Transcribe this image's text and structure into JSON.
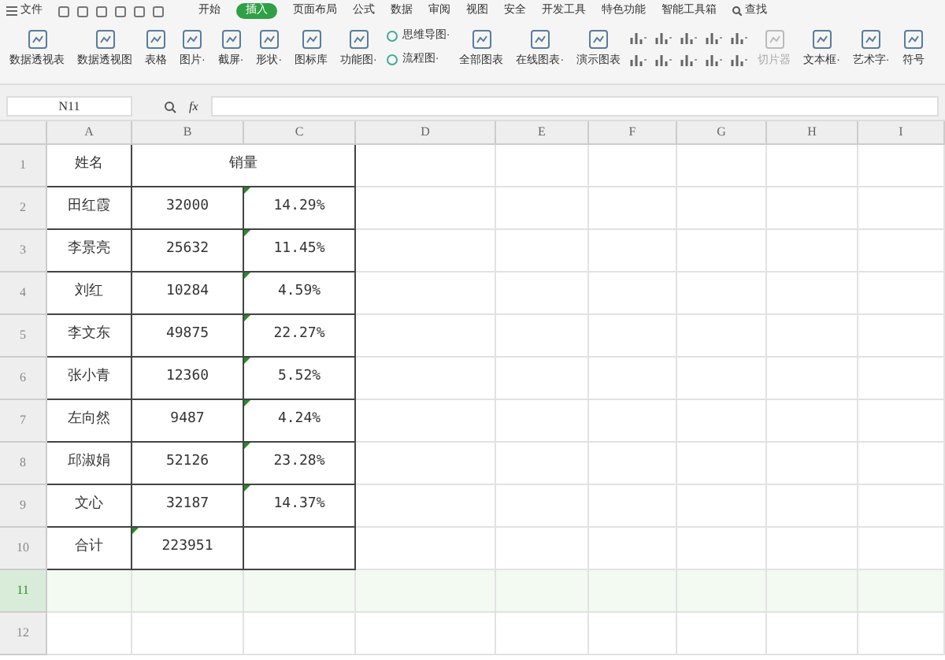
{
  "menu": {
    "file": "文件",
    "tabs": [
      {
        "label": "开始",
        "selected": false
      },
      {
        "label": "插入",
        "selected": true
      },
      {
        "label": "页面布局",
        "selected": false
      },
      {
        "label": "公式",
        "selected": false
      },
      {
        "label": "数据",
        "selected": false
      },
      {
        "label": "审阅",
        "selected": false
      },
      {
        "label": "视图",
        "selected": false
      },
      {
        "label": "安全",
        "selected": false
      },
      {
        "label": "开发工具",
        "selected": false
      },
      {
        "label": "特色功能",
        "selected": false
      },
      {
        "label": "智能工具箱",
        "selected": false
      }
    ],
    "search": "查找"
  },
  "ribbon": [
    {
      "kind": "large",
      "label": "数据透视表",
      "disabled": false
    },
    {
      "kind": "large",
      "label": "数据透视图",
      "disabled": false
    },
    {
      "kind": "large",
      "label": "表格",
      "disabled": false
    },
    {
      "kind": "large",
      "label": "图片·",
      "disabled": false
    },
    {
      "kind": "large",
      "label": "截屏·",
      "disabled": false
    },
    {
      "kind": "large",
      "label": "形状·",
      "disabled": false
    },
    {
      "kind": "large",
      "label": "图标库",
      "disabled": false
    },
    {
      "kind": "large",
      "label": "功能图·",
      "disabled": false
    },
    {
      "kind": "pair",
      "labels": [
        "思维导图·",
        "流程图·"
      ]
    },
    {
      "kind": "large",
      "label": "全部图表",
      "disabled": false
    },
    {
      "kind": "large",
      "label": "在线图表·",
      "disabled": false
    },
    {
      "kind": "large",
      "label": "演示图表",
      "disabled": false
    },
    {
      "kind": "charts"
    },
    {
      "kind": "large",
      "label": "切片器",
      "disabled": true
    },
    {
      "kind": "large",
      "label": "文本框·",
      "disabled": false
    },
    {
      "kind": "large",
      "label": "艺术字·",
      "disabled": false
    },
    {
      "kind": "large",
      "label": "符号",
      "disabled": false
    }
  ],
  "formula_bar": {
    "cell_ref": "N11",
    "fx": "fx"
  },
  "columns": [
    "A",
    "B",
    "C",
    "D",
    "E",
    "F",
    "G",
    "H",
    "I"
  ],
  "rows": [
    {
      "header": "1",
      "cells": [
        {
          "text": "姓名",
          "flagged": false
        },
        {
          "text": "销量",
          "flagged": false,
          "kind": "merged"
        }
      ]
    },
    {
      "header": "2",
      "cells": [
        {
          "text": "田红霞",
          "flagged": false
        },
        {
          "text": "32000",
          "flagged": false
        },
        {
          "text": "14.29%",
          "flagged": true
        }
      ]
    },
    {
      "header": "3",
      "cells": [
        {
          "text": "李景亮",
          "flagged": false
        },
        {
          "text": "25632",
          "flagged": false
        },
        {
          "text": "11.45%",
          "flagged": true
        }
      ]
    },
    {
      "header": "4",
      "cells": [
        {
          "text": "刘红",
          "flagged": false
        },
        {
          "text": "10284",
          "flagged": false
        },
        {
          "text": "4.59%",
          "flagged": true
        }
      ]
    },
    {
      "header": "5",
      "cells": [
        {
          "text": "李文东",
          "flagged": false
        },
        {
          "text": "49875",
          "flagged": false
        },
        {
          "text": "22.27%",
          "flagged": true
        }
      ]
    },
    {
      "header": "6",
      "cells": [
        {
          "text": "张小青",
          "flagged": false
        },
        {
          "text": "12360",
          "flagged": false
        },
        {
          "text": "5.52%",
          "flagged": true
        }
      ]
    },
    {
      "header": "7",
      "cells": [
        {
          "text": "左向然",
          "flagged": false
        },
        {
          "text": "9487",
          "flagged": false
        },
        {
          "text": "4.24%",
          "flagged": true
        }
      ]
    },
    {
      "header": "8",
      "cells": [
        {
          "text": "邱淑娟",
          "flagged": false
        },
        {
          "text": "52126",
          "flagged": false
        },
        {
          "text": "23.28%",
          "flagged": true
        }
      ]
    },
    {
      "header": "9",
      "cells": [
        {
          "text": "文心",
          "flagged": false
        },
        {
          "text": "32187",
          "flagged": false
        },
        {
          "text": "14.37%",
          "flagged": true
        }
      ]
    },
    {
      "header": "10",
      "cells": [
        {
          "text": "合计",
          "flagged": false
        },
        {
          "text": "223951",
          "flagged": true
        },
        {
          "text": "",
          "flagged": false
        }
      ]
    },
    {
      "header": "11",
      "selected": true,
      "cells": []
    },
    {
      "header": "12",
      "selected": false,
      "cells": []
    }
  ]
}
